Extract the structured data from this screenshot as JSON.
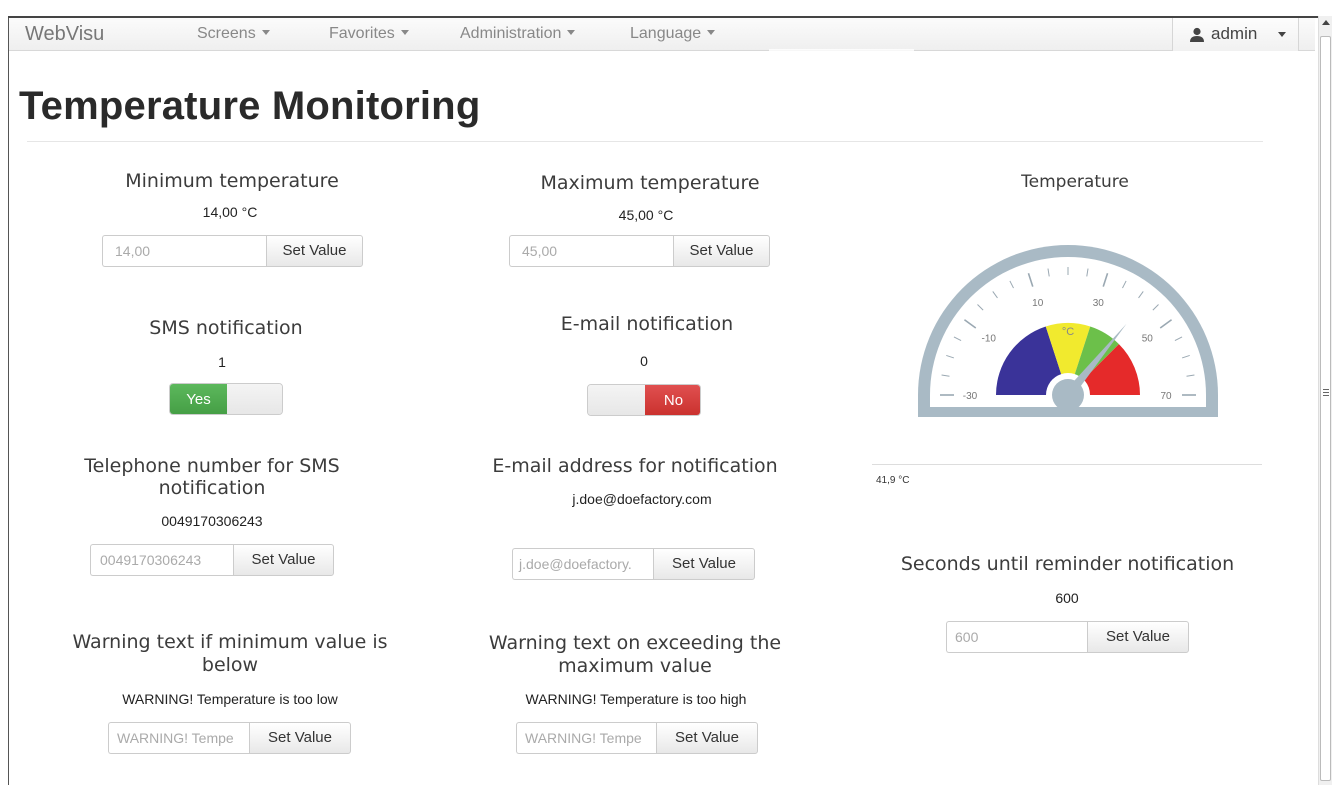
{
  "app": {
    "brand": "WebVisu",
    "nav": [
      "Screens",
      "Favorites",
      "Administration",
      "Language"
    ],
    "user": "admin"
  },
  "page": {
    "title": "Temperature Monitoring"
  },
  "fields": {
    "min_temp": {
      "label": "Minimum temperature",
      "value": "14,00 °C",
      "input": "14,00",
      "button": "Set Value"
    },
    "max_temp": {
      "label": "Maximum temperature",
      "value": "45,00 °C",
      "input": "45,00",
      "button": "Set Value"
    },
    "sms_notification": {
      "label": "SMS notification",
      "value": "1",
      "toggle_on": "Yes"
    },
    "email_notification": {
      "label": "E-mail notification",
      "value": "0",
      "toggle_off": "No"
    },
    "sms_phone": {
      "label_line1": "Telephone number for SMS",
      "label_line2": "notification",
      "value": "0049170306243",
      "input": "0049170306243",
      "button": "Set Value"
    },
    "email_address": {
      "label": "E-mail address for notification",
      "value": "j.doe@doefactory.com",
      "input": "j.doe@doefactory.",
      "button": "Set Value"
    },
    "warn_min": {
      "label_line1": "Warning text if minimum value is",
      "label_line2": "below",
      "value": "WARNING! Temperature is too low",
      "input": "WARNING! Tempe",
      "button": "Set Value"
    },
    "warn_max": {
      "label_line1": "Warning text on exceeding the",
      "label_line2": "maximum value",
      "value": "WARNING! Temperature is too high",
      "input": "WARNING! Tempe",
      "button": "Set Value"
    },
    "reminder": {
      "label": "Seconds until reminder notification",
      "value": "600",
      "input": "600",
      "button": "Set Value"
    }
  },
  "gauge": {
    "title": "Temperature",
    "unit": "°C",
    "min": -30,
    "max": 70,
    "value": 41.9,
    "reading": "41,9 °C",
    "tick_labels": [
      "-30",
      "-10",
      "10",
      "30",
      "50",
      "70"
    ],
    "bands": [
      {
        "from": -30,
        "to": 10,
        "color": "#3a3399"
      },
      {
        "from": 10,
        "to": 30,
        "color": "#f1ea2e"
      },
      {
        "from": 30,
        "to": 45,
        "color": "#6cc04a"
      },
      {
        "from": 45,
        "to": 70,
        "color": "#e52a2a"
      }
    ]
  }
}
